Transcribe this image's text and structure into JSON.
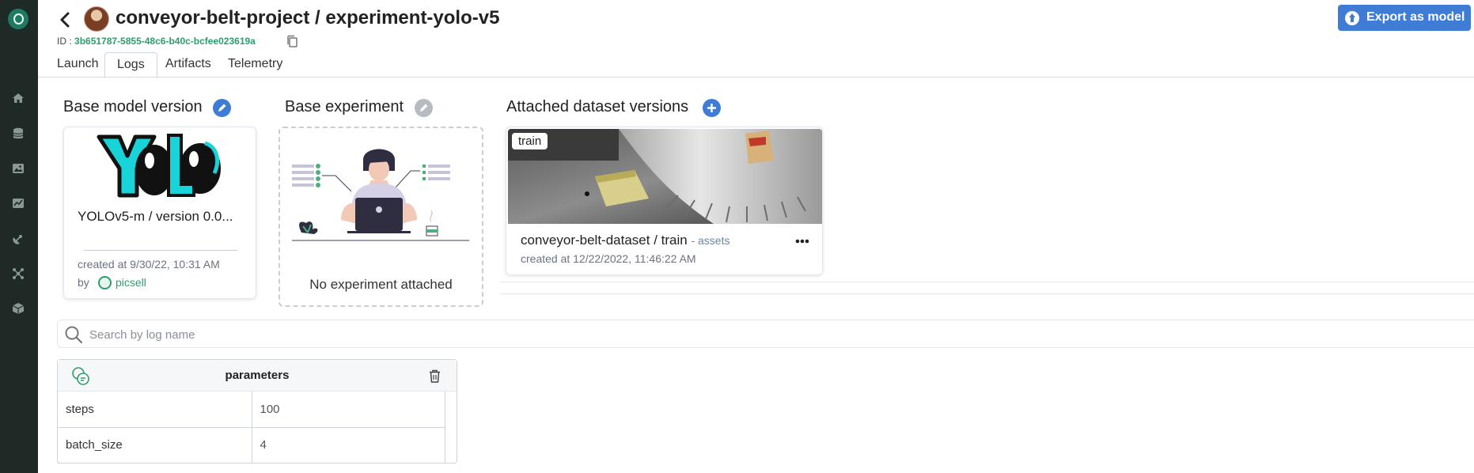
{
  "app": {
    "sidebar": {
      "items": [
        {
          "icon": "home-icon"
        },
        {
          "icon": "datalake-icon"
        },
        {
          "icon": "images-icon"
        },
        {
          "icon": "charts-icon"
        },
        {
          "icon": "satellite-icon"
        },
        {
          "icon": "network-icon"
        },
        {
          "icon": "cube-icon"
        }
      ]
    }
  },
  "header": {
    "title": "conveyor-belt-project / experiment-yolo-v5",
    "id_label": "ID :",
    "id_value": "3b651787-5855-48c6-b40c-bcfee023619a",
    "export_label": "Export as model"
  },
  "tabs": [
    {
      "label": "Launch"
    },
    {
      "label": "Logs",
      "active": true
    },
    {
      "label": "Artifacts"
    },
    {
      "label": "Telemetry"
    }
  ],
  "base_model": {
    "title": "Base model version",
    "name": "YOLOv5-m / version 0.0...",
    "created": "created at 9/30/22, 10:31 AM",
    "by_label": "by",
    "user": "picsell"
  },
  "base_experiment": {
    "title": "Base experiment",
    "empty_text": "No experiment attached"
  },
  "datasets": {
    "title": "Attached dataset versions",
    "items": [
      {
        "badge": "train",
        "name": "conveyor-belt-dataset / train",
        "type": "- assets",
        "created": "created at 12/22/2022, 11:46:22 AM"
      }
    ]
  },
  "search": {
    "placeholder": "Search by log name",
    "value": ""
  },
  "logs": [
    {
      "title": "parameters",
      "rows": [
        {
          "key": "steps",
          "value": "100"
        },
        {
          "key": "batch_size",
          "value": "4"
        }
      ]
    }
  ],
  "colors": {
    "sidebar_bg": "#1f2a26",
    "accent_blue": "#3f7cd6",
    "accent_green": "#2e9d6e"
  }
}
